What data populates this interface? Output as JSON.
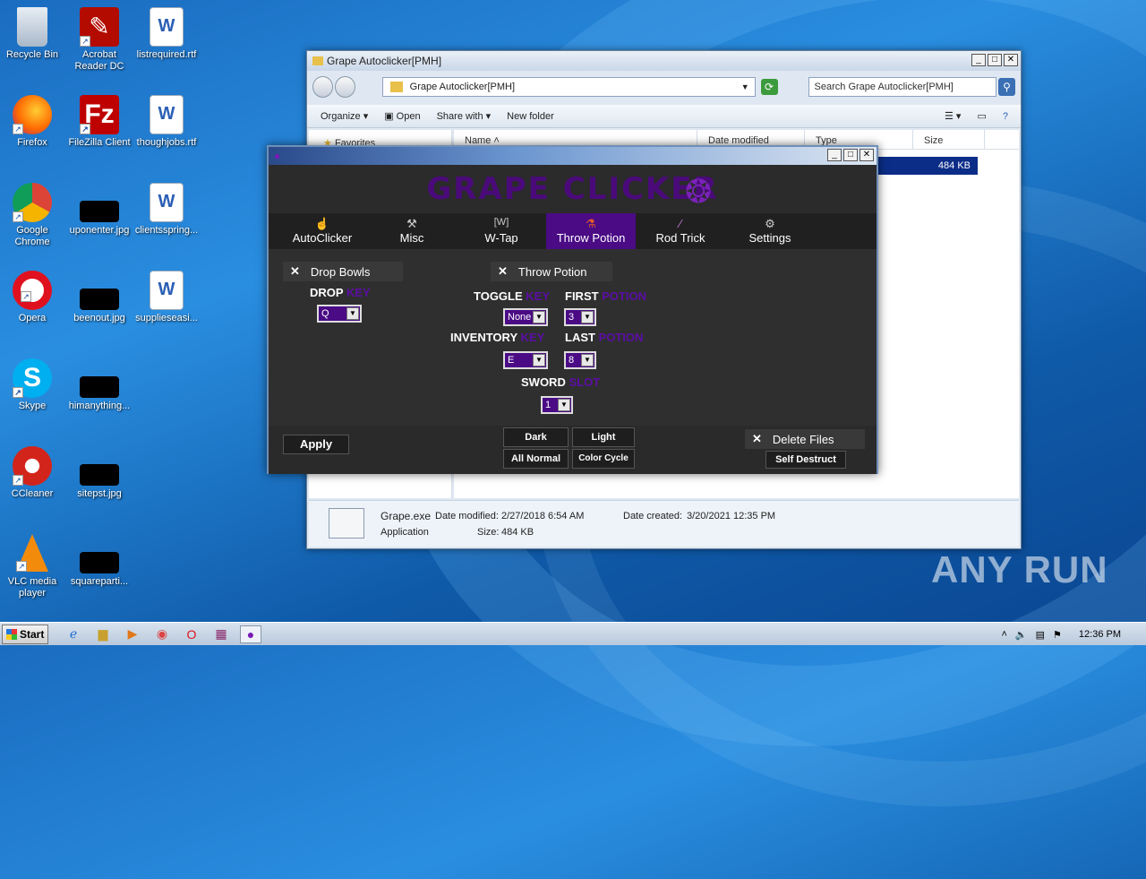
{
  "desktop": {
    "icons": [
      {
        "label": "Recycle Bin"
      },
      {
        "label": "Acrobat Reader DC"
      },
      {
        "label": "listrequired.rtf"
      },
      {
        "label": "Firefox"
      },
      {
        "label": "FileZilla Client"
      },
      {
        "label": "thoughjobs.rtf"
      },
      {
        "label": "Google Chrome"
      },
      {
        "label": "uponenter.jpg"
      },
      {
        "label": "clientsspring..."
      },
      {
        "label": "Opera"
      },
      {
        "label": "beenout.jpg"
      },
      {
        "label": "supplieseasi..."
      },
      {
        "label": "Skype"
      },
      {
        "label": "himanything..."
      },
      {
        "label": "CCleaner"
      },
      {
        "label": "sitepst.jpg"
      },
      {
        "label": "VLC media player"
      },
      {
        "label": "squareparti..."
      }
    ],
    "watermark": "ANY RUN"
  },
  "explorer": {
    "title": "Grape Autoclicker[PMH]",
    "address": "Grape Autoclicker[PMH]",
    "search_placeholder": "Search Grape Autoclicker[PMH]",
    "toolbar": [
      "Organize",
      "Open",
      "Share with",
      "New folder"
    ],
    "columns": [
      "Name",
      "Date modified",
      "Type",
      "Size"
    ],
    "nav_first": "Favorites",
    "selected_size": "484 KB",
    "details": {
      "name": "Grape.exe",
      "modified_label": "Date modified:",
      "modified": "2/27/2018 6:54 AM",
      "created_label": "Date created:",
      "created": "3/20/2021 12:35 PM",
      "type": "Application",
      "size_label": "Size:",
      "size": "484 KB"
    }
  },
  "grape": {
    "banner": "GRAPE CLICKER",
    "tabs": [
      {
        "label": "AutoClicker",
        "icon": "cursor-icon"
      },
      {
        "label": "Misc",
        "icon": "wrench-icon"
      },
      {
        "label": "W-Tap",
        "icon": "w-key-icon"
      },
      {
        "label": "Throw Potion",
        "icon": "potion-icon"
      },
      {
        "label": "Rod Trick",
        "icon": "rod-icon"
      },
      {
        "label": "Settings",
        "icon": "gear-icon"
      }
    ],
    "active_tab": "Throw Potion",
    "drop_bowls": {
      "check": "✕",
      "label": "Drop Bowls",
      "drop": "DROP",
      "key": "KEY",
      "value": "Q"
    },
    "throw_potion": {
      "check": "✕",
      "label": "Throw Potion",
      "toggle": "TOGGLE",
      "toggle_key": "KEY",
      "toggle_value": "None",
      "first": "FIRST",
      "first_potion": "POTION",
      "first_value": "3",
      "inventory": "INVENTORY",
      "inventory_key": "KEY",
      "inventory_value": "E",
      "last": "LAST",
      "last_potion": "POTION",
      "last_value": "8",
      "sword": "SWORD",
      "sword_slot": "SLOT",
      "sword_value": "1"
    },
    "footer": {
      "apply": "Apply",
      "dark": "Dark",
      "light": "Light",
      "all_normal": "All Normal",
      "color_cycle": "Color Cycle",
      "delete_check": "✕",
      "delete_files": "Delete Files",
      "self_destruct": "Self Destruct"
    },
    "accent": "#4a0b85"
  },
  "taskbar": {
    "start": "Start",
    "time": "12:36 PM"
  }
}
